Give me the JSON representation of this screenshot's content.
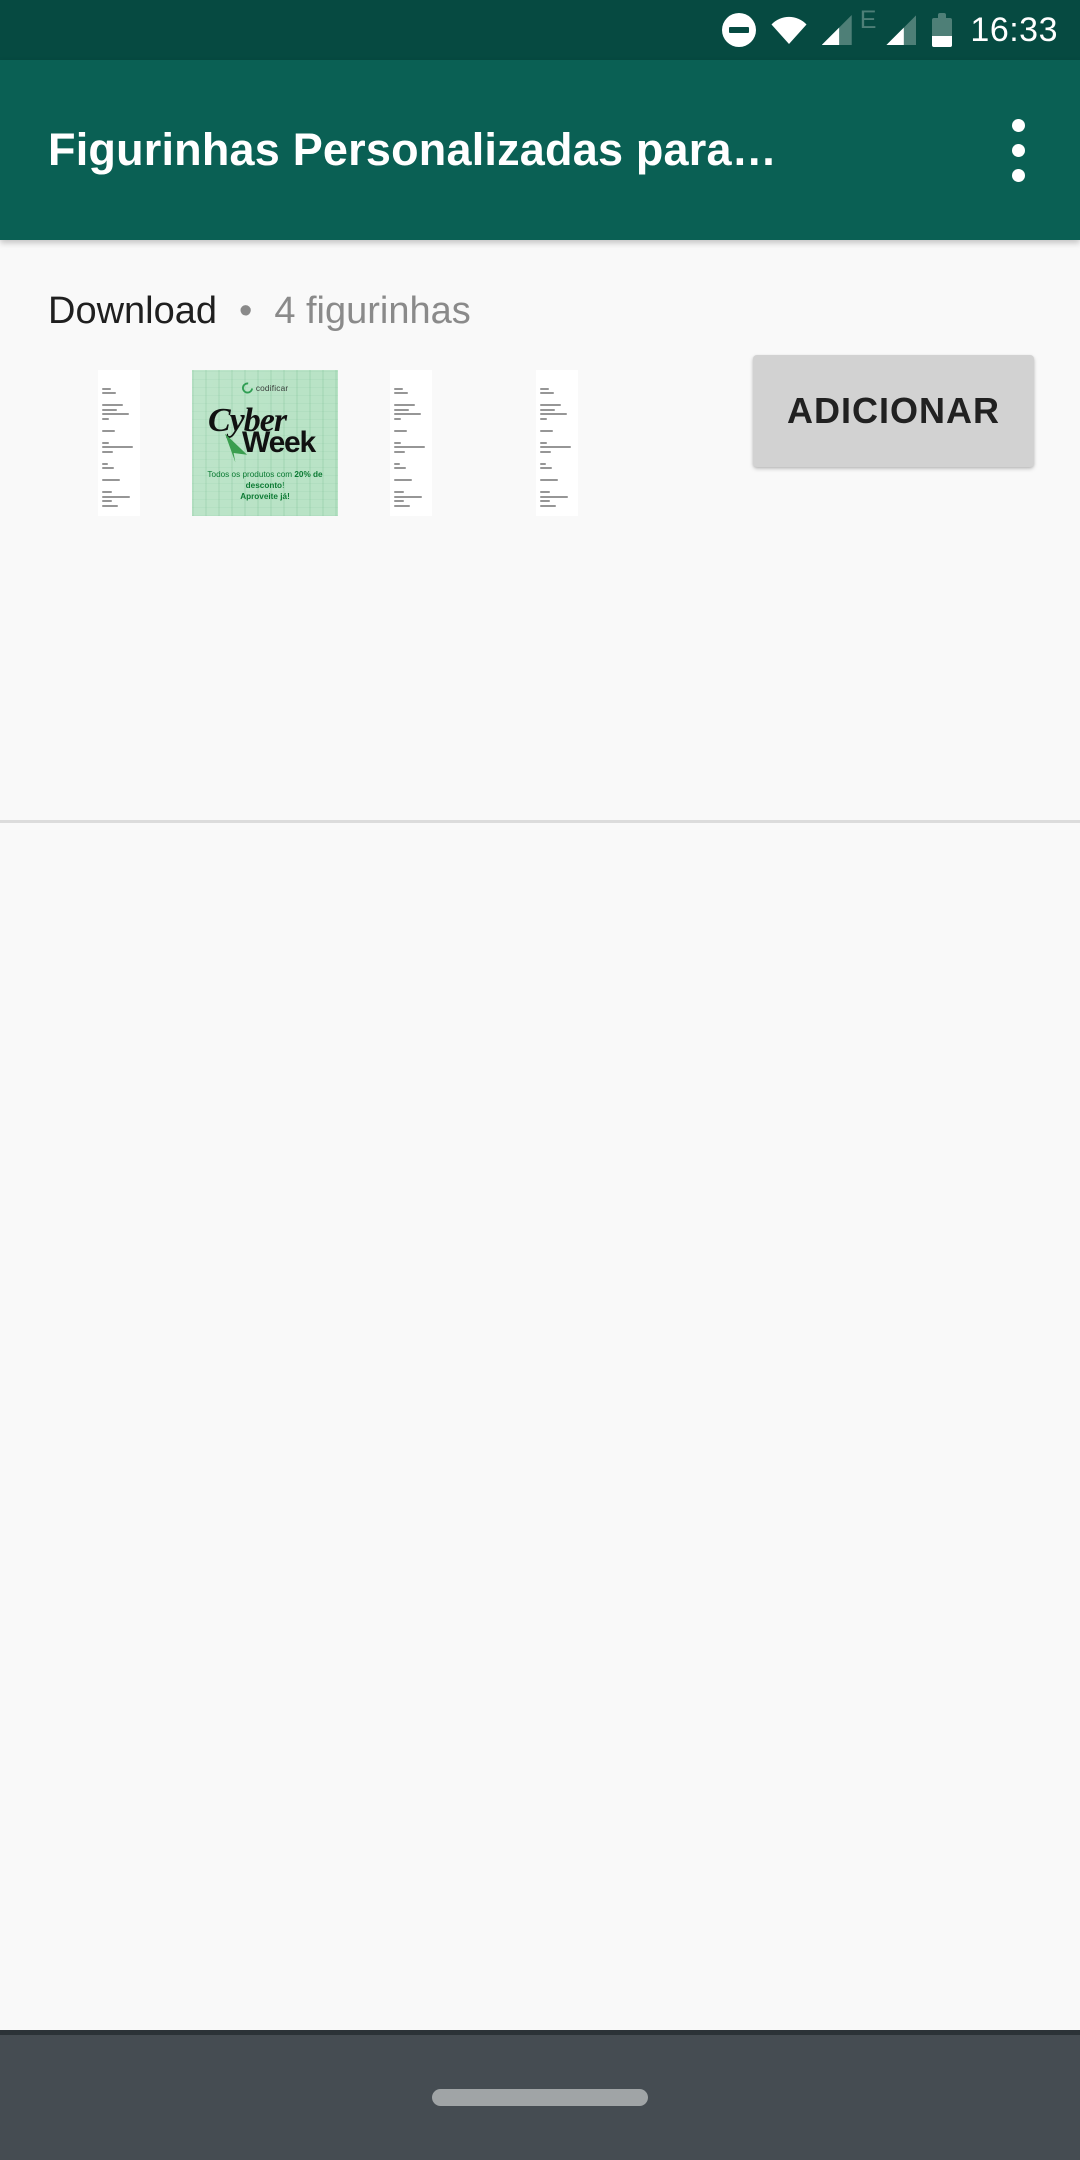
{
  "status_bar": {
    "icons": [
      "do-not-disturb-icon",
      "wifi-icon",
      "signal-sim1-icon",
      "signal-sim2-icon",
      "battery-icon"
    ],
    "network_type": "E",
    "time": "16:33",
    "background_color": "#064a41"
  },
  "app_bar": {
    "title": "Figurinhas Personalizadas para…",
    "overflow_menu": "overflow-menu-icon",
    "background_color": "#0a6054",
    "text_color": "#ffffff"
  },
  "pack": {
    "name": "Download",
    "separator": "•",
    "count_label": "4 figurinhas",
    "add_button_label": "ADICIONAR",
    "add_button_color": "#d2d2d2",
    "stickers": [
      {
        "type": "document",
        "name": "sticker-thumbnail-document-1",
        "header_color": "#8b2fc9"
      },
      {
        "type": "image",
        "name": "sticker-thumbnail-cyber-week",
        "brand": "codificar",
        "title_line1": "Cyber",
        "title_line2": "Week",
        "promo_line1": "Todos os produtos com ",
        "promo_highlight": "20% de desconto",
        "promo_line1_end": "!",
        "promo_line2": "Aproveite já!",
        "background_color": "#b9e3c6",
        "accent_color": "#0c7a33"
      },
      {
        "type": "document",
        "name": "sticker-thumbnail-document-2",
        "header_color": "#8b2fc9"
      },
      {
        "type": "document",
        "name": "sticker-thumbnail-document-3",
        "header_color": "#8b2fc9"
      }
    ]
  },
  "navigation_bar": {
    "handle": "home-gesture-handle",
    "background_color": "#454c52"
  }
}
